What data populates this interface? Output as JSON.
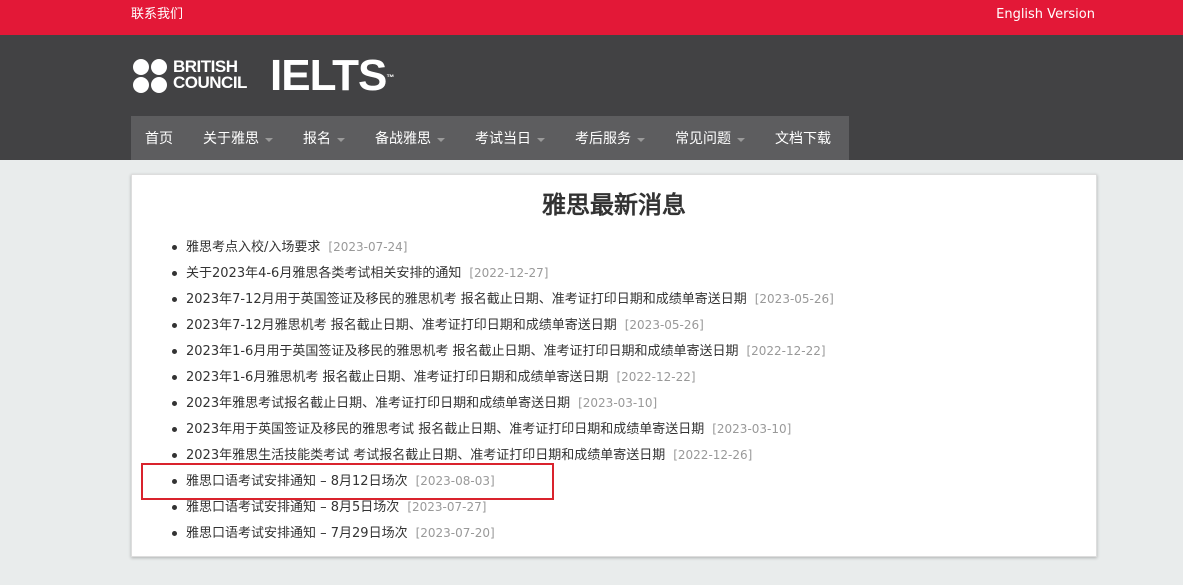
{
  "topbar": {
    "contact": "联系我们",
    "english": "English Version"
  },
  "logo": {
    "bc_line1": "BRITISH",
    "bc_line2": "COUNCIL",
    "ielts": "IELTS",
    "tm": "™"
  },
  "nav": [
    {
      "label": "首页",
      "dropdown": false
    },
    {
      "label": "关于雅思",
      "dropdown": true
    },
    {
      "label": "报名",
      "dropdown": true
    },
    {
      "label": "备战雅思",
      "dropdown": true
    },
    {
      "label": "考试当日",
      "dropdown": true
    },
    {
      "label": "考后服务",
      "dropdown": true
    },
    {
      "label": "常见问题",
      "dropdown": true
    },
    {
      "label": "文档下载",
      "dropdown": false
    }
  ],
  "main": {
    "title": "雅思最新消息",
    "news": [
      {
        "title": "雅思考点入校/入场要求",
        "date": "[2023-07-24]"
      },
      {
        "title": "关于2023年4-6月雅思各类考试相关安排的通知",
        "date": "[2022-12-27]"
      },
      {
        "title": "2023年7-12月用于英国签证及移民的雅思机考 报名截止日期、准考证打印日期和成绩单寄送日期",
        "date": "[2023-05-26]"
      },
      {
        "title": "2023年7-12月雅思机考 报名截止日期、准考证打印日期和成绩单寄送日期",
        "date": "[2023-05-26]"
      },
      {
        "title": "2023年1-6月用于英国签证及移民的雅思机考 报名截止日期、准考证打印日期和成绩单寄送日期",
        "date": "[2022-12-22]"
      },
      {
        "title": "2023年1-6月雅思机考 报名截止日期、准考证打印日期和成绩单寄送日期",
        "date": "[2022-12-22]"
      },
      {
        "title": "2023年雅思考试报名截止日期、准考证打印日期和成绩单寄送日期",
        "date": "[2023-03-10]"
      },
      {
        "title": "2023年用于英国签证及移民的雅思考试 报名截止日期、准考证打印日期和成绩单寄送日期",
        "date": "[2023-03-10]"
      },
      {
        "title": "2023年雅思生活技能类考试 考试报名截止日期、准考证打印日期和成绩单寄送日期",
        "date": "[2022-12-26]"
      },
      {
        "title": "雅思口语考试安排通知 – 8月12日场次",
        "date": "[2023-08-03]"
      },
      {
        "title": "雅思口语考试安排通知 – 8月5日场次",
        "date": "[2023-07-27]"
      },
      {
        "title": "雅思口语考试安排通知 – 7月29日场次",
        "date": "[2023-07-20]"
      }
    ]
  },
  "colors": {
    "topbar": "#e31837",
    "header": "#424244",
    "nav": "#5d5d5f",
    "highlight": "#d9232d"
  }
}
